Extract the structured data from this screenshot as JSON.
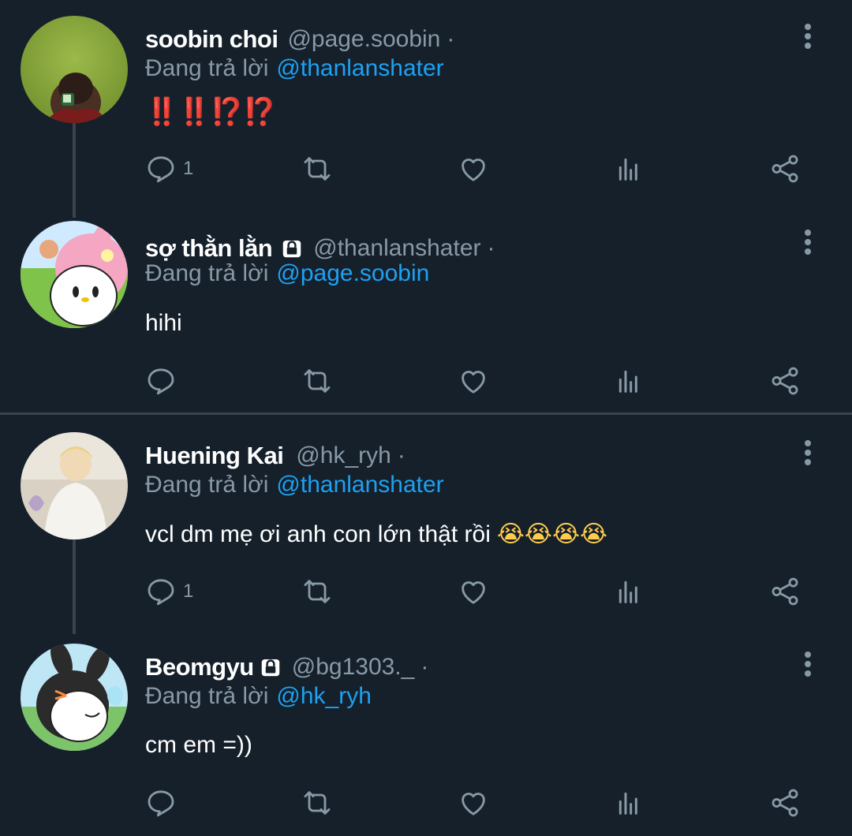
{
  "tweets": [
    {
      "name": "soobin choi",
      "handle": "@page.soobin",
      "dot": "·",
      "locked": false,
      "reply_prefix": "Đang trả lời",
      "reply_to": "@thanlanshater",
      "text": "‼️‼️⁉️⁉️",
      "reply_count": "1",
      "avatar_icon": "photo-avatar-green"
    },
    {
      "name": "sợ thằn lằn",
      "handle": "@thanlanshater",
      "dot": "·",
      "locked": true,
      "reply_prefix": "Đang trả lời",
      "reply_to": "@page.soobin",
      "text": "hihi",
      "reply_count": "",
      "avatar_icon": "my-melody-avatar"
    },
    {
      "name": "Huening Kai",
      "handle": "@hk_ryh",
      "dot": "·",
      "locked": false,
      "reply_prefix": "Đang trả lời",
      "reply_to": "@thanlanshater",
      "text": "vcl dm mẹ ơi anh con lớn thật rồi",
      "text_emojis": "😭😭😭😭",
      "reply_count": "1",
      "avatar_icon": "photo-avatar-person"
    },
    {
      "name": "Beomgyu",
      "handle": "@bg1303._",
      "dot": "·",
      "locked": true,
      "reply_prefix": "Đang trả lời",
      "reply_to": "@hk_ryh",
      "text": "cm em =))",
      "reply_count": "",
      "avatar_icon": "kuromi-avatar"
    }
  ],
  "colors": {
    "background": "#15202b",
    "secondary_text": "#8899a6",
    "mention": "#1da1f2",
    "divider": "#38444d"
  },
  "icons": {
    "reply": "reply-icon",
    "retweet": "retweet-icon",
    "like": "heart-icon",
    "analytics": "analytics-icon",
    "share": "share-icon",
    "more": "more-vertical-icon"
  }
}
